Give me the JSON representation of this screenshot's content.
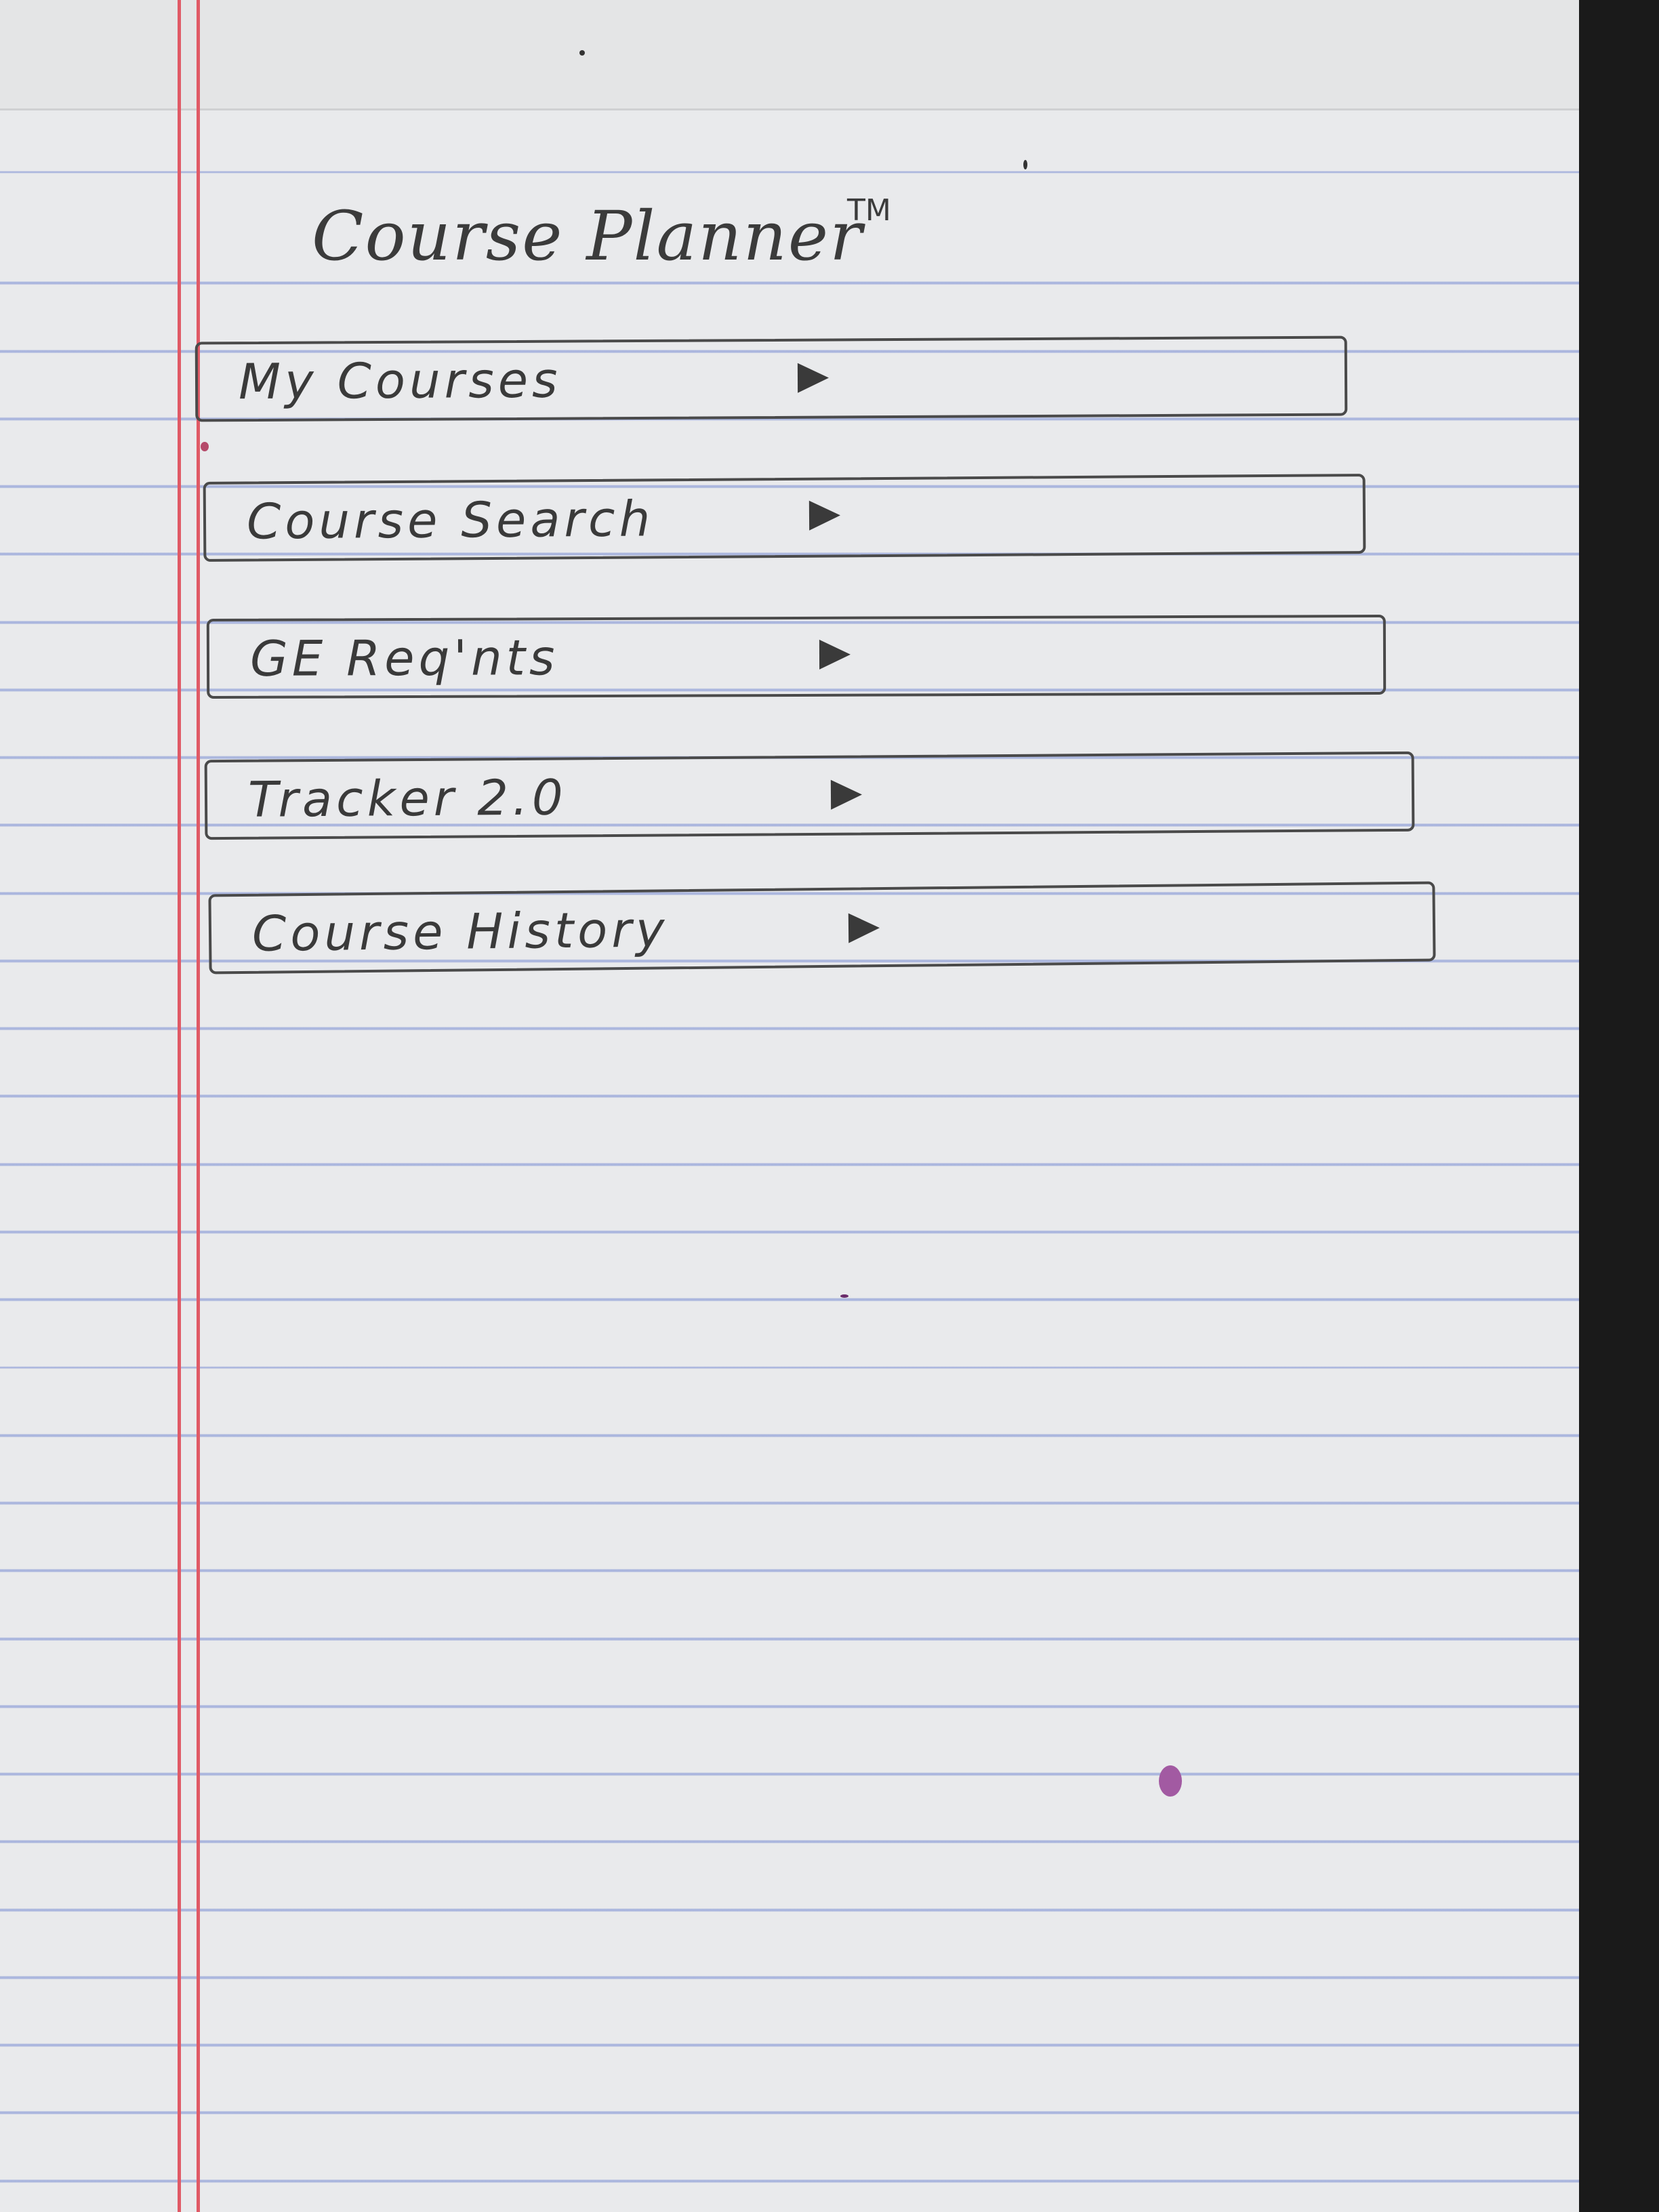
{
  "app": {
    "title": "Course Planner",
    "trademark": "TM"
  },
  "menu": {
    "items": [
      {
        "label": "My Courses"
      },
      {
        "label": "Course Search"
      },
      {
        "label": "GE Req'nts"
      },
      {
        "label": "Tracker 2.0"
      },
      {
        "label": "Course History"
      }
    ]
  },
  "colors": {
    "paper": "#e9eaec",
    "rule_line": "#788cd2",
    "margin_line": "#e05a66",
    "pencil": "#3a3a3a"
  }
}
